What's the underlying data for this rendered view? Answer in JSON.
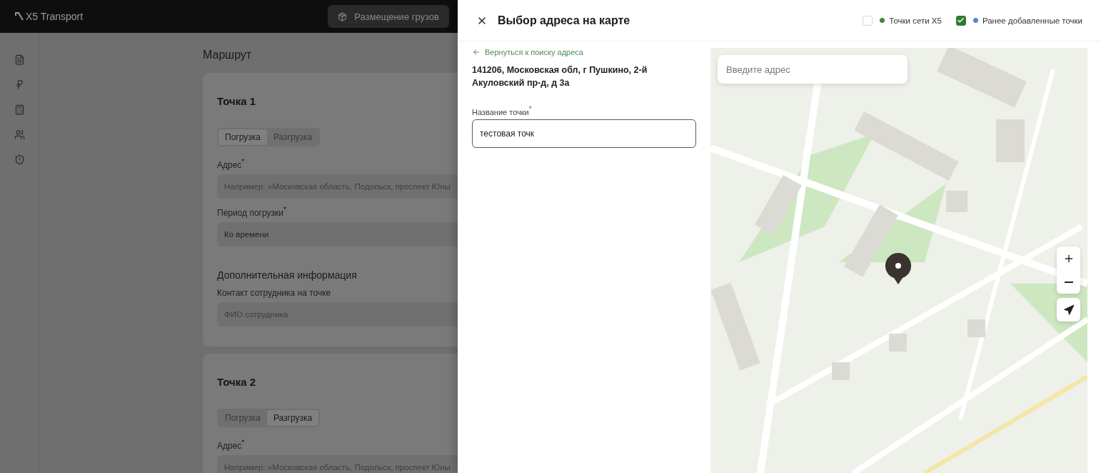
{
  "header": {
    "logo": "X5 Transport",
    "action": "Размещение грузов"
  },
  "page": {
    "title": "Маршрут",
    "points": [
      {
        "title": "Точка 1",
        "tabs": [
          {
            "label": "Погрузка",
            "selected": true
          },
          {
            "label": "Разгрузка",
            "selected": false
          }
        ],
        "fields": [
          {
            "label": "Адрес$^{*}$",
            "placeholder": "Например: «Московская область, Подольск, проспект Юны"
          },
          {
            "label": "Период погрузки$^{*}$",
            "value": "Ко времени"
          }
        ],
        "extra": {
          "title": "Дополнительная информация",
          "fields": [
            {
              "label": "Контакт сотрудника на точке",
              "placeholder": "ФИО сотрудника"
            }
          ]
        }
      },
      {
        "title": "Точка 2",
        "tabs": [
          {
            "label": "Погрузка",
            "selected": false
          },
          {
            "label": "Разгрузка",
            "selected": true
          }
        ],
        "fields": [
          {
            "label": "Адрес$^{*}$",
            "placeholder": "Например: «Московская область, Подольск, проспект Юны"
          }
        ]
      }
    ]
  },
  "modal": {
    "title": "Выбор адреса на карте",
    "legend": [
      {
        "label": "Точки сети X5",
        "checked": false,
        "color": "#3f8a3a"
      },
      {
        "label": "Ранее добавленные точки",
        "checked": true,
        "color": "#5a83d8"
      }
    ],
    "back_link": "Вернуться к поиску адреса",
    "address": "141206, Московская обл, г Пушкино, 2-й Акуловский пр-д, д 3а",
    "name_field": {
      "label": "Название точки$^{*}$",
      "value": "тестовая точк"
    },
    "map": {
      "search": {
        "placeholder": "Введите адрес"
      }
    }
  }
}
